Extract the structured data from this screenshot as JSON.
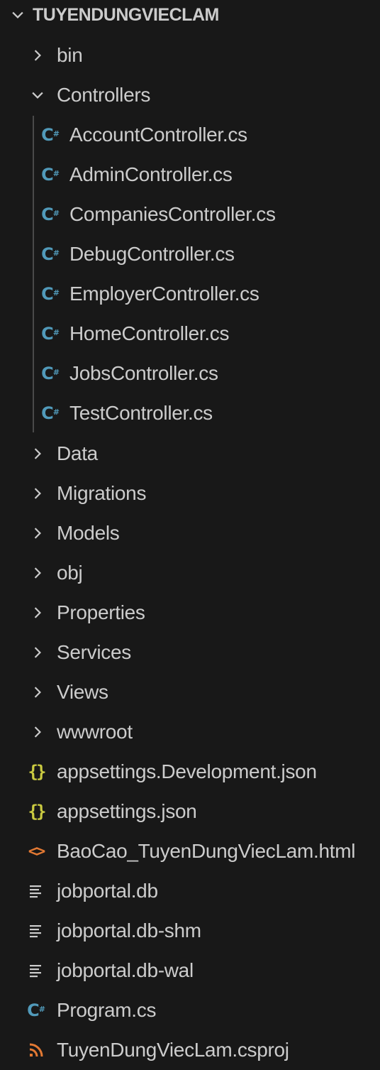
{
  "explorer": {
    "root": {
      "label": "TUYENDUNGVIECLAM",
      "expanded": true
    },
    "items": [
      {
        "label": "bin",
        "type": "folder",
        "expanded": false
      },
      {
        "label": "Controllers",
        "type": "folder",
        "expanded": true
      },
      {
        "label": "AccountController.cs",
        "type": "csharp"
      },
      {
        "label": "AdminController.cs",
        "type": "csharp"
      },
      {
        "label": "CompaniesController.cs",
        "type": "csharp"
      },
      {
        "label": "DebugController.cs",
        "type": "csharp"
      },
      {
        "label": "EmployerController.cs",
        "type": "csharp"
      },
      {
        "label": "HomeController.cs",
        "type": "csharp"
      },
      {
        "label": "JobsController.cs",
        "type": "csharp"
      },
      {
        "label": "TestController.cs",
        "type": "csharp"
      },
      {
        "label": "Data",
        "type": "folder",
        "expanded": false
      },
      {
        "label": "Migrations",
        "type": "folder",
        "expanded": false
      },
      {
        "label": "Models",
        "type": "folder",
        "expanded": false
      },
      {
        "label": "obj",
        "type": "folder",
        "expanded": false
      },
      {
        "label": "Properties",
        "type": "folder",
        "expanded": false
      },
      {
        "label": "Services",
        "type": "folder",
        "expanded": false
      },
      {
        "label": "Views",
        "type": "folder",
        "expanded": false
      },
      {
        "label": "wwwroot",
        "type": "folder",
        "expanded": false
      },
      {
        "label": "appsettings.Development.json",
        "type": "json"
      },
      {
        "label": "appsettings.json",
        "type": "json"
      },
      {
        "label": "BaoCao_TuyenDungViecLam.html",
        "type": "html"
      },
      {
        "label": "jobportal.db",
        "type": "database"
      },
      {
        "label": "jobportal.db-shm",
        "type": "database"
      },
      {
        "label": "jobportal.db-wal",
        "type": "database"
      },
      {
        "label": "Program.cs",
        "type": "csharp"
      },
      {
        "label": "TuyenDungViecLam.csproj",
        "type": "csproj"
      }
    ]
  },
  "icons": {
    "chevron_right": "chevron-right-icon",
    "chevron_down": "chevron-down-icon",
    "csharp": "csharp-file-icon",
    "json": "json-file-icon",
    "html": "html-file-icon",
    "database": "database-file-icon",
    "csproj": "csproj-file-icon"
  },
  "colors": {
    "background": "#181818",
    "text": "#cccccc",
    "csharp": "#519aba",
    "json": "#cbcb41",
    "html": "#e37933",
    "csproj": "#e37933",
    "database": "#cccccc",
    "indent_guide": "#4a4a4a"
  }
}
